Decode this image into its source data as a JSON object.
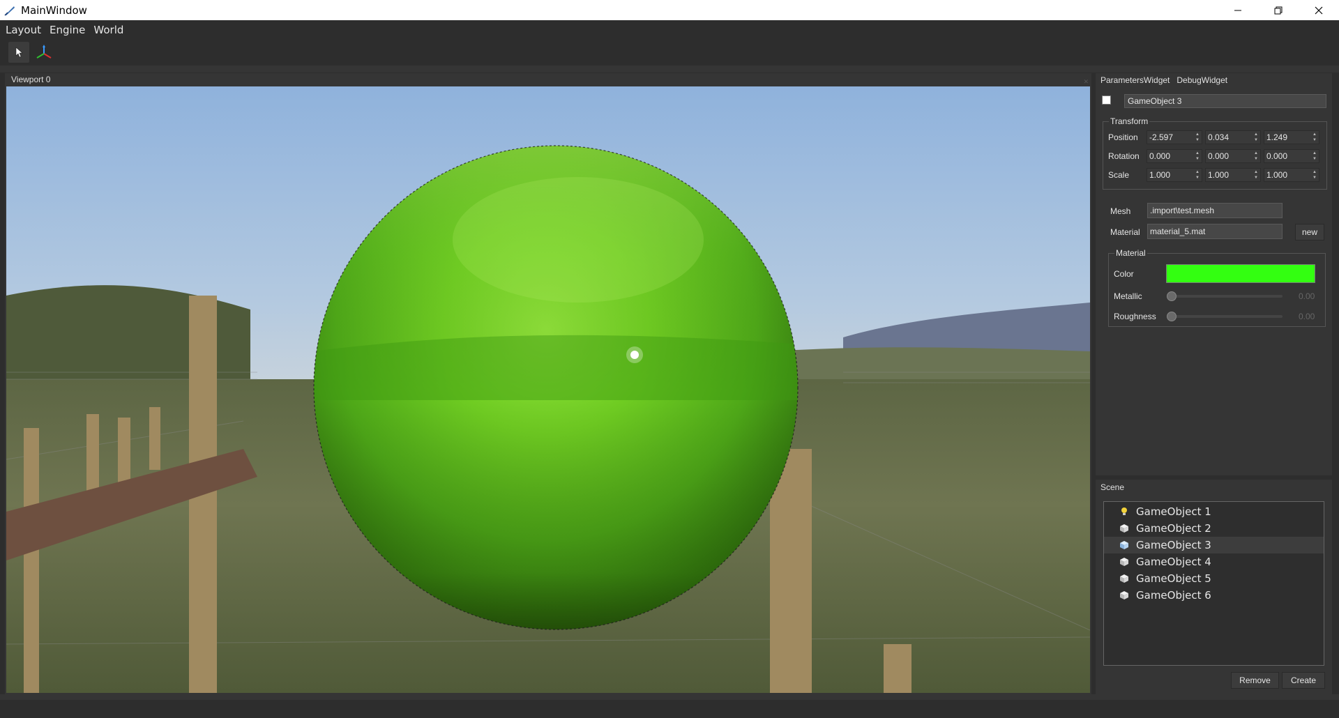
{
  "window": {
    "title": "MainWindow"
  },
  "menu": {
    "items": [
      "Layout",
      "Engine",
      "World"
    ]
  },
  "toolbar": {
    "tools": [
      "select-cursor-icon",
      "gizmo-axes-icon"
    ]
  },
  "viewport": {
    "title": "Viewport 0"
  },
  "params": {
    "tabs": [
      "ParametersWidget",
      "DebugWidget"
    ],
    "object_name": "GameObject 3",
    "enabled": true,
    "transform": {
      "title": "Transform",
      "position_label": "Position",
      "rotation_label": "Rotation",
      "scale_label": "Scale",
      "position": [
        "-2.597",
        "0.034",
        "1.249"
      ],
      "rotation": [
        "0.000",
        "0.000",
        "0.000"
      ],
      "scale": [
        "1.000",
        "1.000",
        "1.000"
      ]
    },
    "mesh_label": "Mesh",
    "mesh_value": ".import\\test.mesh",
    "material_label": "Material",
    "material_value": "material_5.mat",
    "new_button": "new",
    "material_group": {
      "title": "Material",
      "color_label": "Color",
      "color": "#33ff11",
      "metallic_label": "Metallic",
      "metallic_value": "0.00",
      "roughness_label": "Roughness",
      "roughness_value": "0.00"
    }
  },
  "scene": {
    "title": "Scene",
    "items": [
      {
        "name": "GameObject 1",
        "icon": "light-bulb-icon"
      },
      {
        "name": "GameObject 2",
        "icon": "cube-icon"
      },
      {
        "name": "GameObject 3",
        "icon": "cube-icon",
        "selected": true
      },
      {
        "name": "GameObject 4",
        "icon": "cube-icon"
      },
      {
        "name": "GameObject 5",
        "icon": "cube-icon"
      },
      {
        "name": "GameObject 6",
        "icon": "cube-icon"
      }
    ],
    "remove_button": "Remove",
    "create_button": "Create"
  }
}
